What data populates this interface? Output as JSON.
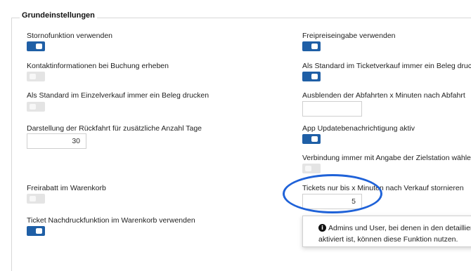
{
  "section": {
    "title": "Grundeinstellungen"
  },
  "left": {
    "storno": {
      "label": "Stornofunktion verwenden",
      "state": "on"
    },
    "kontakt": {
      "label": "Kontaktinformationen bei Buchung erheben",
      "state": "off"
    },
    "einzelverkauf_beleg": {
      "label": "Als Standard im Einzelverkauf immer ein Beleg drucken",
      "state": "off"
    },
    "rueckfahrt_tage": {
      "label": "Darstellung der Rückfahrt für zusätzliche Anzahl Tage",
      "value": "30"
    },
    "freirabatt": {
      "label": "Freirabatt im Warenkorb",
      "state": "off"
    },
    "nachdruck": {
      "label": "Ticket Nachdruckfunktion im Warenkorb verwenden",
      "state": "on"
    }
  },
  "right": {
    "freipreis": {
      "label": "Freipreiseingabe verwenden",
      "state": "on"
    },
    "ticketverkauf_beleg": {
      "label": "Als Standard im Ticketverkauf immer ein Beleg drucken",
      "state": "on"
    },
    "abfahrten_minuten": {
      "label": "Ausblenden der Abfahrten x Minuten nach Abfahrt",
      "value": ""
    },
    "app_update": {
      "label": "App Updatebenachrichtigung aktiv",
      "state": "on"
    },
    "zielstation": {
      "label": "Verbindung immer mit Angabe der Zielstation wählen",
      "state": "off"
    },
    "storno_minuten": {
      "label": "Tickets nur bis x Minuten nach Verkauf stornieren",
      "value": "5"
    }
  },
  "tooltip": {
    "icon": "info-icon",
    "line1": "Admins und User, bei denen in den detaillierten Be",
    "line2": "aktiviert ist, können diese Funktion nutzen."
  },
  "colors": {
    "accent": "#1f5fa6",
    "toggle_off": "#e4e4e4",
    "highlight": "#1f62d8"
  }
}
